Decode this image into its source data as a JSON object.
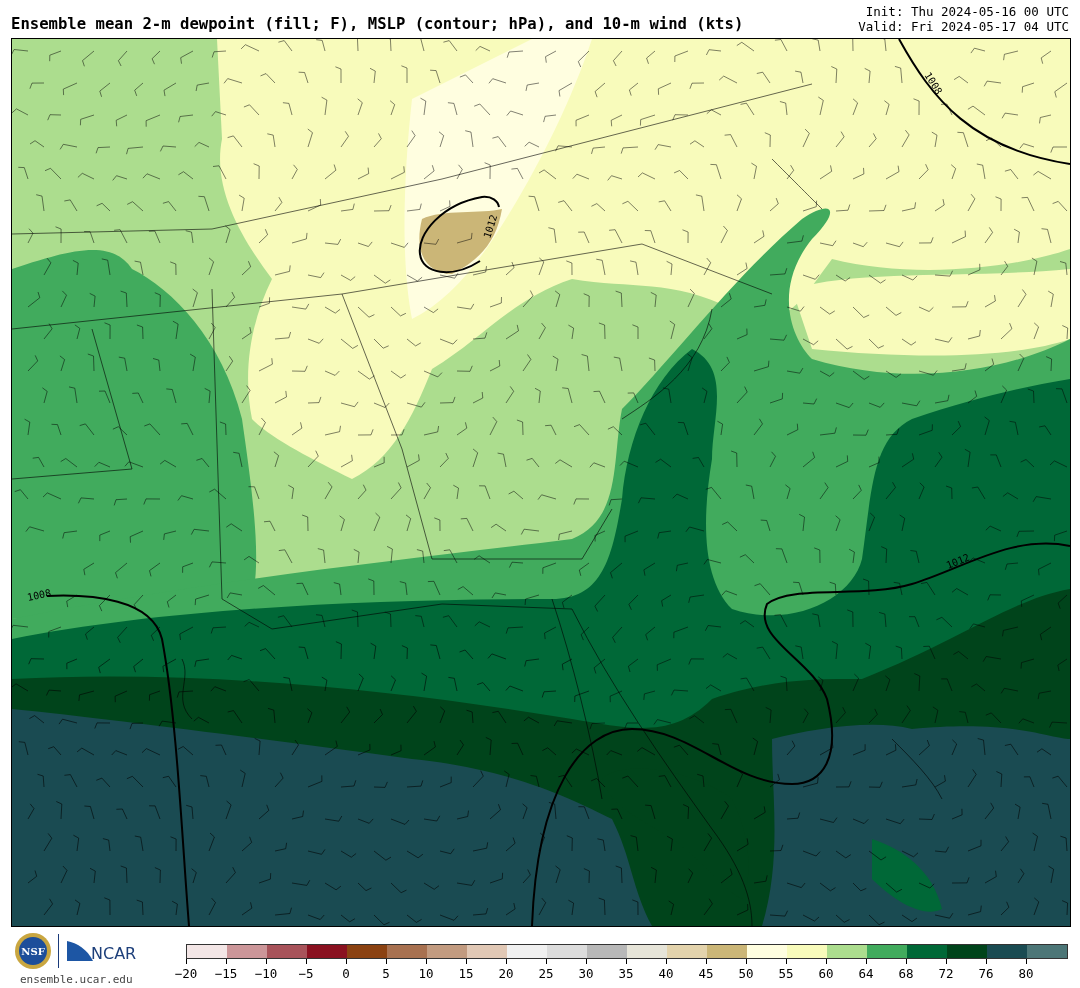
{
  "header": {
    "title": "Ensemble mean 2-m dewpoint (fill; F), MSLP (contour; hPa), and 10-m wind (kts)",
    "init": "Init: Thu 2024-05-16 00 UTC",
    "valid": "Valid: Fri 2024-05-17 04 UTC"
  },
  "map": {
    "contour_labels": [
      {
        "text": "1008"
      },
      {
        "text": "1012"
      },
      {
        "text": "1008"
      },
      {
        "text": "1012"
      }
    ]
  },
  "footer": {
    "logos": [
      "NSF",
      "NCAR"
    ],
    "url": "ensemble.ucar.edu"
  },
  "colorbar": {
    "segments": [
      {
        "color": "#f3e6e6"
      },
      {
        "color": "#cc9699"
      },
      {
        "color": "#a8535a"
      },
      {
        "color": "#8a1120"
      },
      {
        "color": "#8b4212"
      },
      {
        "color": "#a87150"
      },
      {
        "color": "#c29b80"
      },
      {
        "color": "#e1c8b5"
      },
      {
        "color": "#f0f0f0"
      },
      {
        "color": "#dcdcdc"
      },
      {
        "color": "#b8b8b8"
      },
      {
        "color": "#e6e4d8"
      },
      {
        "color": "#e3d3ac"
      },
      {
        "color": "#cbb677"
      },
      {
        "color": "#fffee0"
      },
      {
        "color": "#f8fbbb"
      },
      {
        "color": "#acdd8e"
      },
      {
        "color": "#41ab5d"
      },
      {
        "color": "#006837"
      },
      {
        "color": "#00441b"
      },
      {
        "color": "#1a4b52"
      },
      {
        "color": "#4c7677"
      }
    ],
    "ticks": [
      "−20",
      "−15",
      "−10",
      "−5",
      "0",
      "5",
      "10",
      "15",
      "20",
      "25",
      "30",
      "35",
      "40",
      "45",
      "50",
      "55",
      "60",
      "64",
      "68",
      "72",
      "76",
      "80"
    ]
  }
}
